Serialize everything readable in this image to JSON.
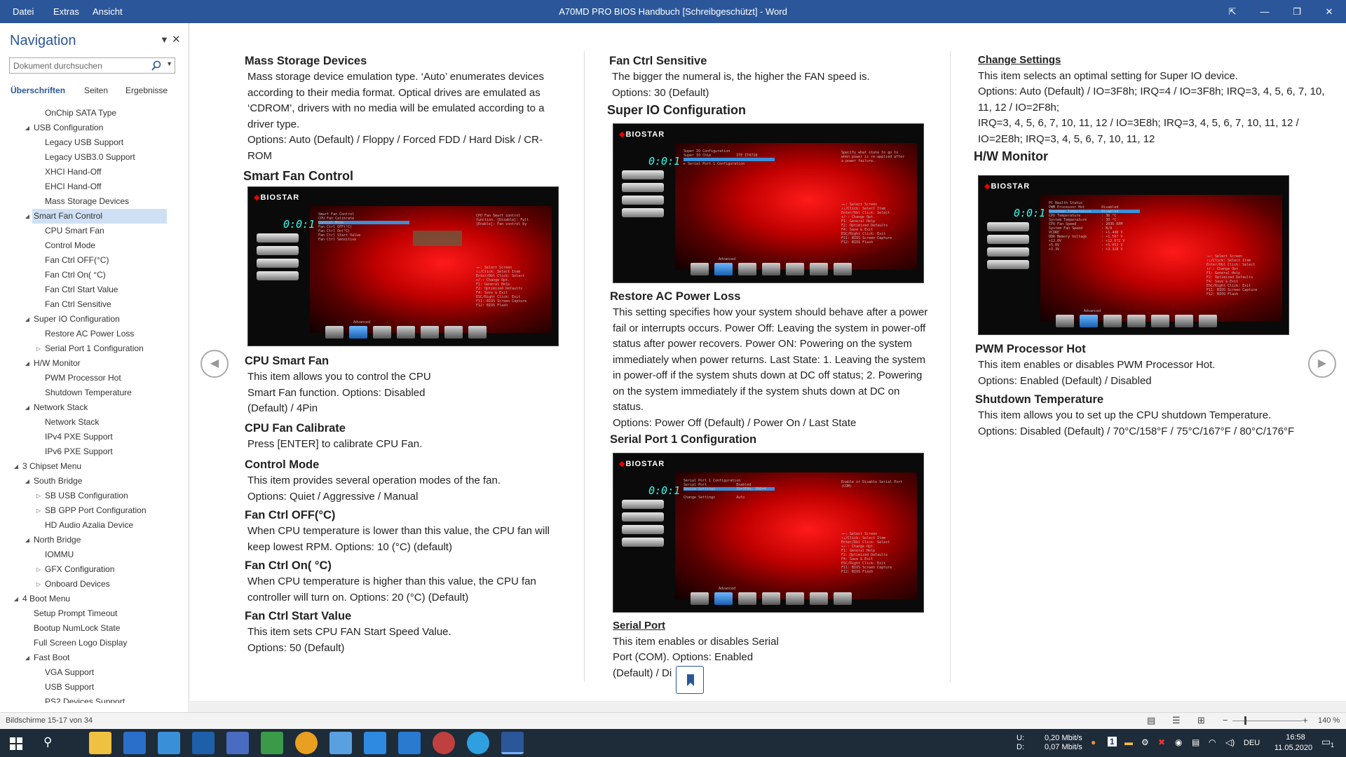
{
  "titlebar": {
    "menu": [
      "Datei",
      "Extras",
      "Ansicht"
    ],
    "title": "A70MD PRO BIOS Handbuch [Schreibgeschützt] - Word",
    "win_icons": [
      "restore-view-icon",
      "minimize-icon",
      "maximize-icon",
      "close-icon"
    ]
  },
  "nav": {
    "title": "Navigation",
    "search_placeholder": "Dokument durchsuchen",
    "tabs": [
      "Überschriften",
      "Seiten",
      "Ergebnisse"
    ],
    "items": [
      {
        "label": "OnChip SATA Type",
        "level": 3,
        "arrow": ""
      },
      {
        "label": "USB Configuration",
        "level": 2,
        "arrow": "down"
      },
      {
        "label": "Legacy USB Support",
        "level": 3,
        "arrow": ""
      },
      {
        "label": "Legacy USB3.0 Support",
        "level": 3,
        "arrow": ""
      },
      {
        "label": "XHCI Hand-Off",
        "level": 3,
        "arrow": ""
      },
      {
        "label": "EHCI Hand-Off",
        "level": 3,
        "arrow": ""
      },
      {
        "label": "Mass Storage Devices",
        "level": 3,
        "arrow": ""
      },
      {
        "label": "Smart Fan Control",
        "level": 2,
        "arrow": "down",
        "selected": true
      },
      {
        "label": "CPU Smart Fan",
        "level": 3,
        "arrow": ""
      },
      {
        "label": "Control Mode",
        "level": 3,
        "arrow": ""
      },
      {
        "label": "Fan Ctrl OFF(°C)",
        "level": 3,
        "arrow": ""
      },
      {
        "label": "Fan Ctrl On( °C)",
        "level": 3,
        "arrow": ""
      },
      {
        "label": "Fan Ctrl Start Value",
        "level": 3,
        "arrow": ""
      },
      {
        "label": "Fan Ctrl Sensitive",
        "level": 3,
        "arrow": ""
      },
      {
        "label": "Super IO Configuration",
        "level": 2,
        "arrow": "down"
      },
      {
        "label": "Restore AC Power Loss",
        "level": 3,
        "arrow": ""
      },
      {
        "label": "Serial Port 1 Configuration",
        "level": 3,
        "arrow": "right"
      },
      {
        "label": "H/W Monitor",
        "level": 2,
        "arrow": "down"
      },
      {
        "label": "PWM Processor Hot",
        "level": 3,
        "arrow": ""
      },
      {
        "label": "Shutdown Temperature",
        "level": 3,
        "arrow": ""
      },
      {
        "label": "Network Stack",
        "level": 2,
        "arrow": "down"
      },
      {
        "label": "Network Stack",
        "level": 3,
        "arrow": ""
      },
      {
        "label": "IPv4 PXE Support",
        "level": 3,
        "arrow": ""
      },
      {
        "label": "IPv6 PXE Support",
        "level": 3,
        "arrow": ""
      },
      {
        "label": "3 Chipset Menu",
        "level": 1,
        "arrow": "down"
      },
      {
        "label": "South Bridge",
        "level": 2,
        "arrow": "down"
      },
      {
        "label": "SB USB Configuration",
        "level": 3,
        "arrow": "right"
      },
      {
        "label": "SB GPP Port Configuration",
        "level": 3,
        "arrow": "right"
      },
      {
        "label": "HD Audio Azalia Device",
        "level": 3,
        "arrow": ""
      },
      {
        "label": "North Bridge",
        "level": 2,
        "arrow": "down"
      },
      {
        "label": "IOMMU",
        "level": 3,
        "arrow": ""
      },
      {
        "label": "GFX Configuration",
        "level": 3,
        "arrow": "right"
      },
      {
        "label": "Onboard Devices",
        "level": 3,
        "arrow": "right"
      },
      {
        "label": "4 Boot Menu",
        "level": 1,
        "arrow": "down"
      },
      {
        "label": "Setup Prompt Timeout",
        "level": 2,
        "arrow": ""
      },
      {
        "label": "Bootup NumLock State",
        "level": 2,
        "arrow": ""
      },
      {
        "label": "Full Screen Logo Display",
        "level": 2,
        "arrow": ""
      },
      {
        "label": "Fast Boot",
        "level": 2,
        "arrow": "down"
      },
      {
        "label": "VGA Support",
        "level": 3,
        "arrow": ""
      },
      {
        "label": "USB Support",
        "level": 3,
        "arrow": ""
      },
      {
        "label": "PS2 Devices Support",
        "level": 3,
        "arrow": ""
      }
    ]
  },
  "doc": {
    "col1": {
      "mass_storage_title": "Mass Storage Devices",
      "mass_storage_text": "Mass storage device emulation type. ‘Auto’ enumerates devices according to their media format. Optical drives are emulated as ‘CDROM’, drivers with no media will be emulated according to a driver type.",
      "mass_storage_options": "Options:  Auto (Default) / Floppy / Forced FDD / Hard Disk / CR-ROM",
      "smart_fan_title": "Smart Fan Control",
      "cpu_smart_fan_title": "CPU Smart Fan",
      "cpu_smart_fan_text": "This item allows you to control the CPU Smart Fan function. Options:  Disabled (Default) / 4Pin",
      "cpu_fan_cal_title": "CPU Fan Calibrate",
      "cpu_fan_cal_text": "Press [ENTER] to calibrate CPU Fan.",
      "control_mode_title": "Control Mode",
      "control_mode_text": "This item provides several operation modes of the fan.",
      "control_mode_options": "Options:  Quiet / Aggressive / Manual",
      "fan_off_title": "Fan Ctrl OFF(°C)",
      "fan_off_text": "When CPU temperature is lower than this value, the CPU fan will keep lowest RPM. Options:  10 (°C) (default)",
      "fan_on_title": "Fan Ctrl On( °C)",
      "fan_on_text": "When CPU temperature is higher than this value, the CPU fan controller will turn on. Options:  20 (°C) (Default)",
      "fan_start_title": "Fan Ctrl Start Value",
      "fan_start_text": "This item sets CPU FAN Start Speed Value.",
      "fan_start_options": "Options:  50 (Default)"
    },
    "col2": {
      "fan_sens_title": "Fan Ctrl Sensitive",
      "fan_sens_text": "The bigger the numeral is, the higher the FAN speed is.",
      "fan_sens_options": "Options:  30 (Default)",
      "superio_title": "Super IO Configuration",
      "restore_title": "Restore AC Power Loss",
      "restore_text": "This setting specifies how your system should behave after a power fail or interrupts occurs. Power Off: Leaving the system in power-off status after power recovers. Power ON: Powering on the system immediately when power returns. Last State: 1. Leaving the system in power-off if the system shuts down at DC off status; 2. Powering on the system immediately if the system shuts down at DC on status.",
      "restore_options": "Options:  Power Off (Default) / Power On / Last State",
      "serial_title": "Serial Port 1 Configuration",
      "serial_port_title": "Serial Port",
      "serial_port_text": "This item enables or disables Serial Port (COM). Options:  Enabled (Default) / Di"
    },
    "col3": {
      "change_title": "Change Settings",
      "change_text": "This item selects an optimal setting for Super IO device.",
      "change_options": "Options:  Auto (Default) / IO=3F8h; IRQ=4 / IO=3F8h; IRQ=3, 4, 5, 6, 7, 10, 11, 12 / IO=2F8h;",
      "change_options2": "IRQ=3, 4, 5, 6, 7, 10, 11, 12 / IO=3E8h; IRQ=3, 4, 5, 6, 7, 10, 11, 12 / IO=2E8h; IRQ=3, 4, 5, 6, 7, 10, 11, 12",
      "hw_title": "H/W Monitor",
      "pwm_title": "PWM Processor Hot",
      "pwm_text": "This item enables or disables PWM Processor Hot.",
      "pwm_options": "Options:  Enabled (Default) / Disabled",
      "shutdown_title": "Shutdown Temperature",
      "shutdown_text": "This item allows you to set up the CPU shutdown Temperature. Options: Disabled (Default) / 70°C/158°F / 75°C/167°F / 80°C/176°F"
    },
    "bios": {
      "logo": "BIOSTAR",
      "clock": "0:0:1",
      "tab": "Advanced"
    }
  },
  "statusbar": {
    "page_info": "Bildschirme 15-17 von 34",
    "zoom": "140 %"
  },
  "taskbar": {
    "net_up_label": "U:",
    "net_down_label": "D:",
    "net_up": "0,20 Mbit/s",
    "net_down": "0,07 Mbit/s",
    "lang": "DEU",
    "time": "16:58",
    "date": "11.05.2020",
    "notification_count": "1"
  }
}
